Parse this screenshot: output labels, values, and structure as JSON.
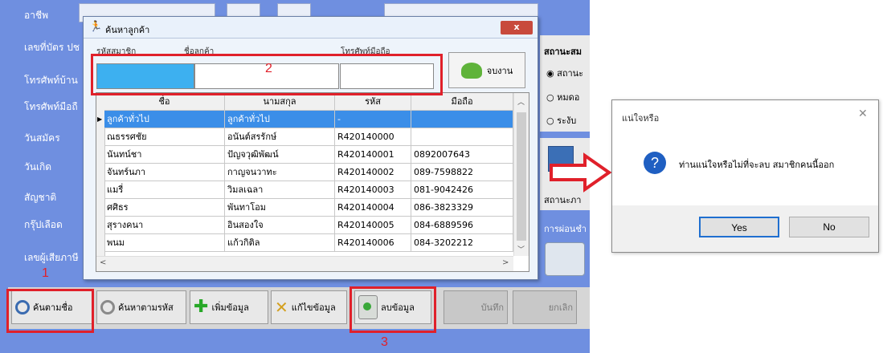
{
  "app": {
    "labels": [
      "อาชีพ",
      "เลขที่บัตร ปช",
      "โทรศัพท์บ้าน",
      "โทรศัพท์มือถื",
      "วันสมัคร",
      "วันเกิด",
      "สัญชาติ",
      "กรุ๊ปเลือด",
      "เลขผู้เสียภาษี"
    ],
    "right_title": "สถานะสม",
    "radios": [
      "สถานะ",
      "หมดอ",
      "ระงับ"
    ],
    "right_label_2": "สถานะภา",
    "right_label_3": "การผ่อนชำ",
    "toolbar": {
      "search_name": "ค้นตามชื่อ",
      "search_code": "ค้นหาตามรหัส",
      "add": "เพิ่มข้อมูล",
      "edit": "แก้ไขข้อมูล",
      "delete": "ลบข้อมูล",
      "save": "บันทึก",
      "cancel": "ยกเลิก"
    }
  },
  "steps": {
    "one": "1",
    "two": "2",
    "three": "3"
  },
  "search_dialog": {
    "title": "ค้นหาลูกค้า",
    "close_label": "x",
    "field_labels": [
      "รหัสสมาชิก",
      "ชื่อลูกค้า",
      "โทรศัพท์มือถือ"
    ],
    "done_button": "จบงาน",
    "columns": [
      "ชื่อ",
      "นามสกุล",
      "รหัส",
      "มือถือ"
    ],
    "rows": [
      [
        "ลูกค้าทั่วไป",
        "ลูกค้าทั่วไป",
        "-",
        ""
      ],
      [
        "ณธรรศชัย",
        "อนันต์สรรักษ์",
        "R420140000",
        ""
      ],
      [
        "นันทน์ชา",
        "ปัญจวุฒิพัฒน์",
        "R420140001",
        "0892007643"
      ],
      [
        "จันทร์นภา",
        "กาญจนวาทะ",
        "R420140002",
        "089-7598822"
      ],
      [
        "แมรี่",
        "วิมลเฉลา",
        "R420140003",
        "081-9042426"
      ],
      [
        "ศศิธร",
        "พันทาโอม",
        "R420140004",
        "086-3823329"
      ],
      [
        "สุรางคนา",
        "อินสองใจ",
        "R420140005",
        "084-6889596"
      ],
      [
        "พนม",
        "แก้วกิติล",
        "R420140006",
        "084-3202212"
      ]
    ]
  },
  "confirm_dialog": {
    "title": "แน่ใจหรือ",
    "message": "ท่านแน่ใจหรือไม่ที่จะลบ สมาชิกคนนี้ออก",
    "yes": "Yes",
    "no": "No",
    "close": "✕",
    "icon": "question-icon"
  },
  "colors": {
    "app_bg": "#6f8fe0",
    "accent_red": "#e0202a",
    "selection": "#3b8ee8"
  }
}
